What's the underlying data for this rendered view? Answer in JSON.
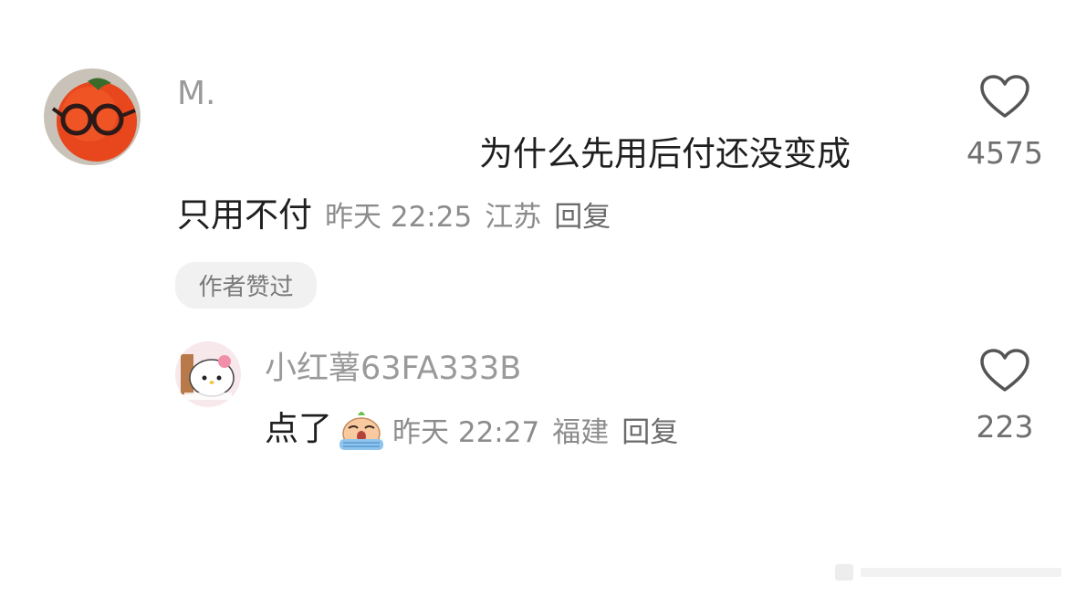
{
  "comment1": {
    "username": "M.",
    "text_line1": "为什么先用后付还没变成",
    "text_line2": "只用不付",
    "time": "昨天 22:25",
    "location": "江苏",
    "reply": "回复",
    "badge": "作者赞过",
    "like_count": "4575"
  },
  "comment2": {
    "username": "小红薯63FA333B",
    "text": "点了",
    "emoji_name": "crying-emoji",
    "time": "昨天 22:27",
    "location": "福建",
    "reply": "回复",
    "like_count": "223"
  },
  "colors": {
    "heart_stroke": "#555555",
    "username": "#9a9a9a",
    "meta": "#8c8c8c",
    "badge_bg": "#f1f1f1"
  }
}
